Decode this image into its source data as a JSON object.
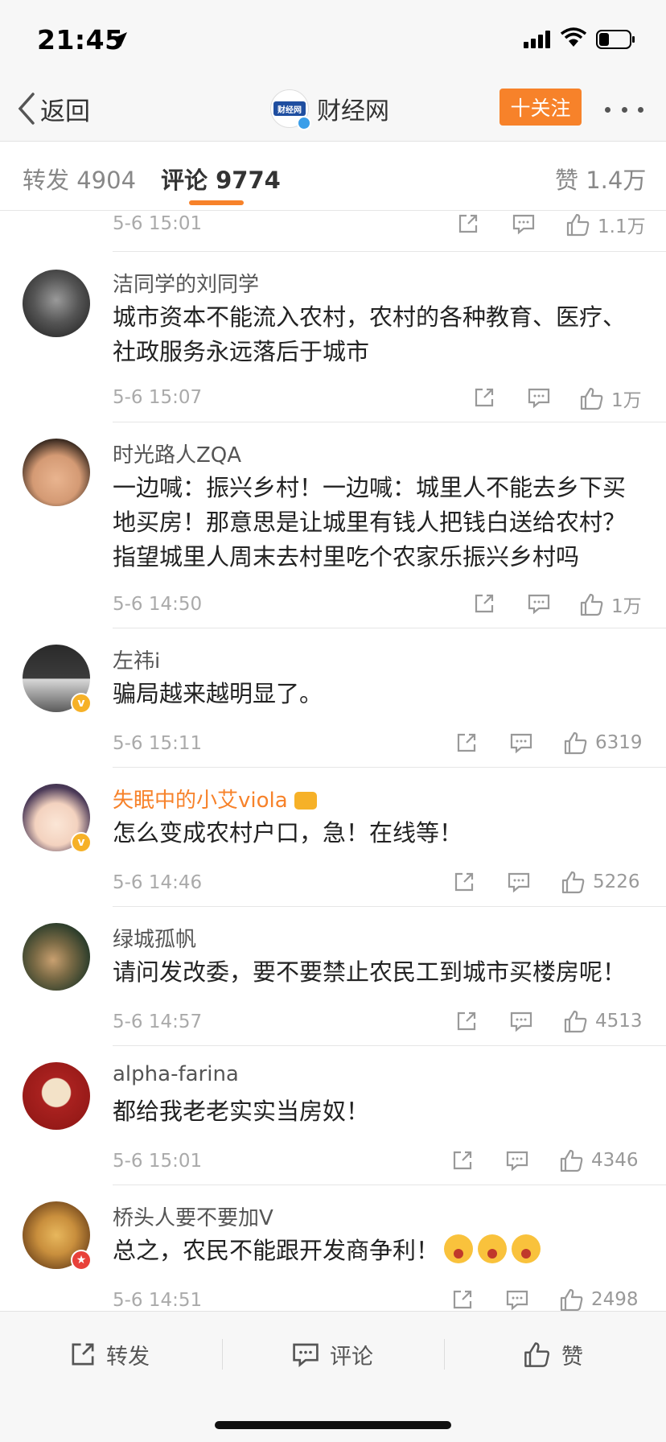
{
  "status": {
    "time": "21:45"
  },
  "nav": {
    "back_label": "返回",
    "title": "财经网",
    "follow_label": "十关注"
  },
  "tabs": [
    {
      "label": "转发 4904"
    },
    {
      "label": "评论 9774"
    },
    {
      "label": "赞 1.4万"
    }
  ],
  "partial_comment": {
    "time": "5-6 15:01",
    "likes": "1.1万"
  },
  "comments": [
    {
      "user": "洁同学的刘同学",
      "text": "城市资本不能流入农村，农村的各种教育、医疗、社政服务永远落后于城市",
      "time": "5-6 15:07",
      "likes": "1万"
    },
    {
      "user": "时光路人ZQA",
      "text": "一边喊：振兴乡村！一边喊：城里人不能去乡下买地买房！那意思是让城里有钱人把钱白送给农村？指望城里人周末去村里吃个农家乐振兴乡村吗",
      "time": "5-6 14:50",
      "likes": "1万"
    },
    {
      "user": "左祎i",
      "text": "骗局越来越明显了。",
      "time": "5-6 15:11",
      "likes": "6319"
    },
    {
      "user": "失眠中的小艾viola",
      "text": "怎么变成农村户口，急！在线等！",
      "time": "5-6 14:46",
      "likes": "5226"
    },
    {
      "user": "绿城孤帆",
      "text": "请问发改委，要不要禁止农民工到城市买楼房呢！",
      "time": "5-6 14:57",
      "likes": "4513"
    },
    {
      "user": "alpha-farina",
      "text": "都给我老老实实当房奴！",
      "time": "5-6 15:01",
      "likes": "4346"
    },
    {
      "user": "桥头人要不要加V",
      "text": "总之，农民不能跟开发商争利！",
      "time": "5-6 14:51",
      "likes": "2498"
    }
  ],
  "bottom_bar": {
    "repost_label": "转发",
    "comment_label": "评论",
    "like_label": "赞"
  },
  "colors": {
    "accent": "#f7822a",
    "verified_yellow": "#f6b128",
    "verified_red": "#e8413a",
    "link_blue": "#3a9ee9"
  }
}
